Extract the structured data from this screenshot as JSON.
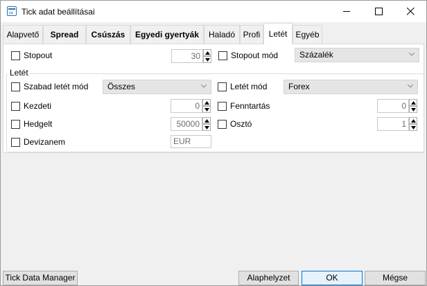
{
  "window": {
    "title": "Tick adat beállításai",
    "icon": "ticket-app-icon"
  },
  "tabs": [
    {
      "label": "Alapvető",
      "bold": false,
      "active": false
    },
    {
      "label": "Spread",
      "bold": true,
      "active": false
    },
    {
      "label": "Csúszás",
      "bold": true,
      "active": false
    },
    {
      "label": "Egyedi gyertyák",
      "bold": true,
      "active": false
    },
    {
      "label": "Haladó",
      "bold": false,
      "active": false
    },
    {
      "label": "Profi",
      "bold": false,
      "active": false
    },
    {
      "label": "Letét",
      "bold": false,
      "active": true
    },
    {
      "label": "Egyéb",
      "bold": false,
      "active": false
    }
  ],
  "stopout": {
    "label": "Stopout",
    "checked": false,
    "value": "30"
  },
  "stopout_mode": {
    "label": "Stopout mód",
    "checked": false,
    "selected": "Százalék"
  },
  "margin_group": {
    "title": "Letét",
    "free_margin_mode": {
      "label": "Szabad letét mód",
      "checked": false,
      "selected": "Összes"
    },
    "margin_mode": {
      "label": "Letét mód",
      "checked": false,
      "selected": "Forex"
    },
    "initial": {
      "label": "Kezdeti",
      "checked": false,
      "value": "0"
    },
    "maintenance": {
      "label": "Fenntartás",
      "checked": false,
      "value": "0"
    },
    "hedged": {
      "label": "Hedgelt",
      "checked": false,
      "value": "50000"
    },
    "divider": {
      "label": "Osztó",
      "checked": false,
      "value": "1"
    },
    "currency": {
      "label": "Devizanem",
      "checked": false,
      "value": "EUR"
    }
  },
  "footer": {
    "manager_label": "Tick Data Manager",
    "reset_label": "Alaphelyzet",
    "ok_label": "OK",
    "cancel_label": "Mégse"
  }
}
